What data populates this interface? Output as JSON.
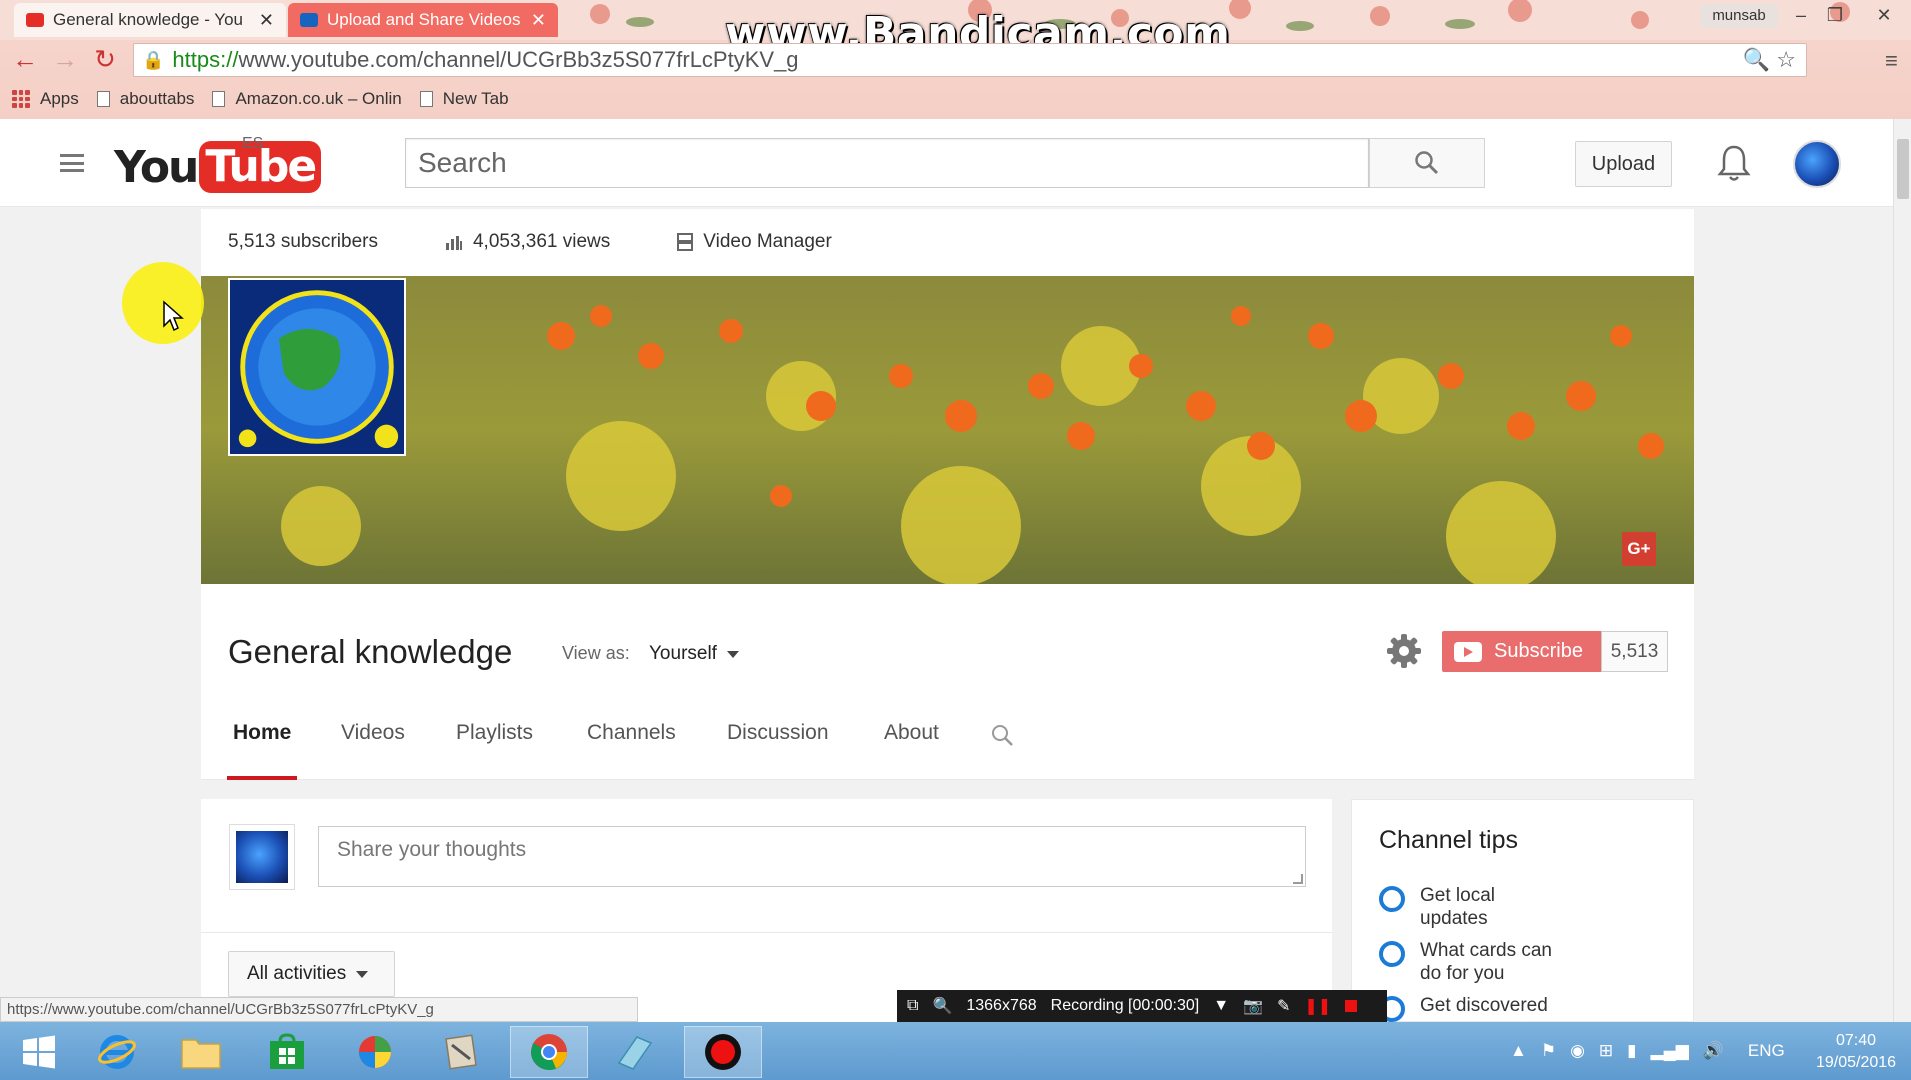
{
  "browser": {
    "tabs": [
      {
        "title": "General knowledge - You",
        "active": true
      },
      {
        "title": "Upload and Share Videos",
        "active": false
      }
    ],
    "watermark": "www.Bandicam.com",
    "user": "munsab",
    "url": {
      "scheme": "https://",
      "rest": "www.youtube.com/channel/UCGrBb3z5S077frLcPtyKV_g"
    },
    "bookmarks": [
      {
        "label": "Apps",
        "icon": "apps-grid-icon"
      },
      {
        "label": "abouttabs",
        "icon": "page-icon"
      },
      {
        "label": "Amazon.co.uk – Onlin",
        "icon": "page-icon"
      },
      {
        "label": "New Tab",
        "icon": "page-icon"
      }
    ]
  },
  "youtube": {
    "logo": {
      "you": "You",
      "tube": "Tube",
      "region": "ES"
    },
    "search_placeholder": "Search",
    "upload_label": "Upload"
  },
  "channel": {
    "stats": {
      "subscribers": "5,513 subscribers",
      "views": "4,053,361 views",
      "video_manager": "Video Manager"
    },
    "title": "General knowledge",
    "view_as_label": "View as:",
    "view_as_value": "Yourself",
    "subscribe_label": "Subscribe",
    "subscriber_count": "5,513",
    "gplus": "G+",
    "tabs": [
      "Home",
      "Videos",
      "Playlists",
      "Channels",
      "Discussion",
      "About"
    ],
    "active_tab": "Home"
  },
  "feed": {
    "share_placeholder": "Share your thoughts",
    "activities_label": "All activities"
  },
  "tips": {
    "title": "Channel tips",
    "items": [
      "Get local updates",
      "What cards can do for you",
      "Get discovered"
    ]
  },
  "status_url": "https://www.youtube.com/channel/UCGrBb3z5S077frLcPtyKV_g",
  "recorder": {
    "resolution": "1366x768",
    "status": "Recording [00:00:30]"
  },
  "taskbar": {
    "language": "ENG",
    "time": "07:40",
    "date": "19/05/2016"
  },
  "colors": {
    "youtube_red": "#e52d27",
    "subscribe_bg": "#e96d6d",
    "tab_underline": "#cc181e",
    "tip_ring": "#1c7bd6",
    "chrome_bg": "#f4cfc5"
  }
}
